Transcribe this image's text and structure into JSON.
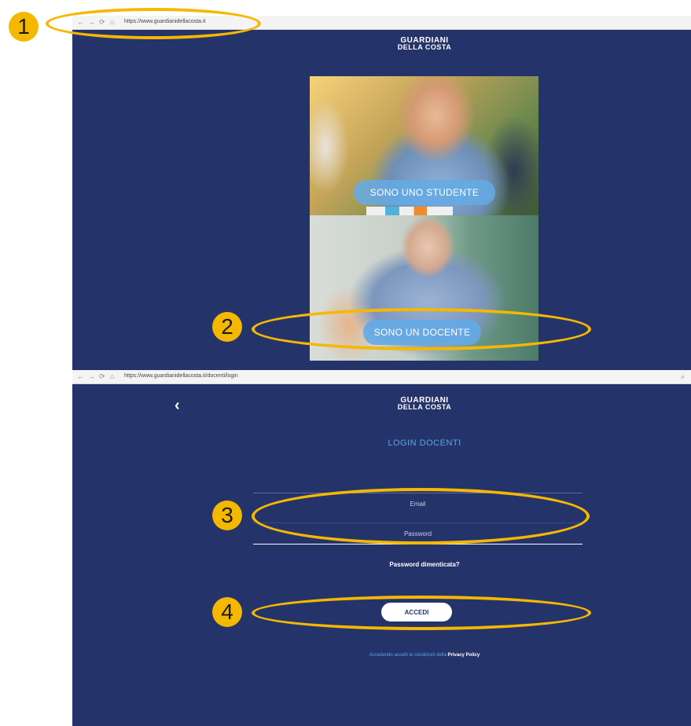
{
  "browser_top": {
    "nav": [
      "←",
      "→",
      "⟳",
      "⌂"
    ],
    "url": "https://www.guardianidellacosta.it"
  },
  "browser_bottom": {
    "nav": [
      "←",
      "→",
      "⟳",
      "⌂"
    ],
    "url": "https://www.guardianidellacosta.it/docenti/login",
    "search_glyph": "⌕"
  },
  "logo": {
    "line1": "GUARDIANI",
    "line2": "DELLA COSTA"
  },
  "role_select": {
    "student_button": "SONO UNO STUDENTE",
    "teacher_button": "SONO UN DOCENTE"
  },
  "login": {
    "back_glyph": "‹",
    "title": "LOGIN DOCENTI",
    "email_placeholder": "Email",
    "password_placeholder": "Password",
    "forgot_link": "Password dimenticata?",
    "submit_label": "ACCEDI",
    "privacy_prefix": "Accedendo accetti le condizioni della",
    "privacy_link": "Privacy Policy"
  },
  "annotations": [
    "1",
    "2",
    "3",
    "4"
  ],
  "colors": {
    "panel_bg": "#25336b",
    "accent_blue": "#5aa7e0",
    "highlight": "#f5b800"
  }
}
